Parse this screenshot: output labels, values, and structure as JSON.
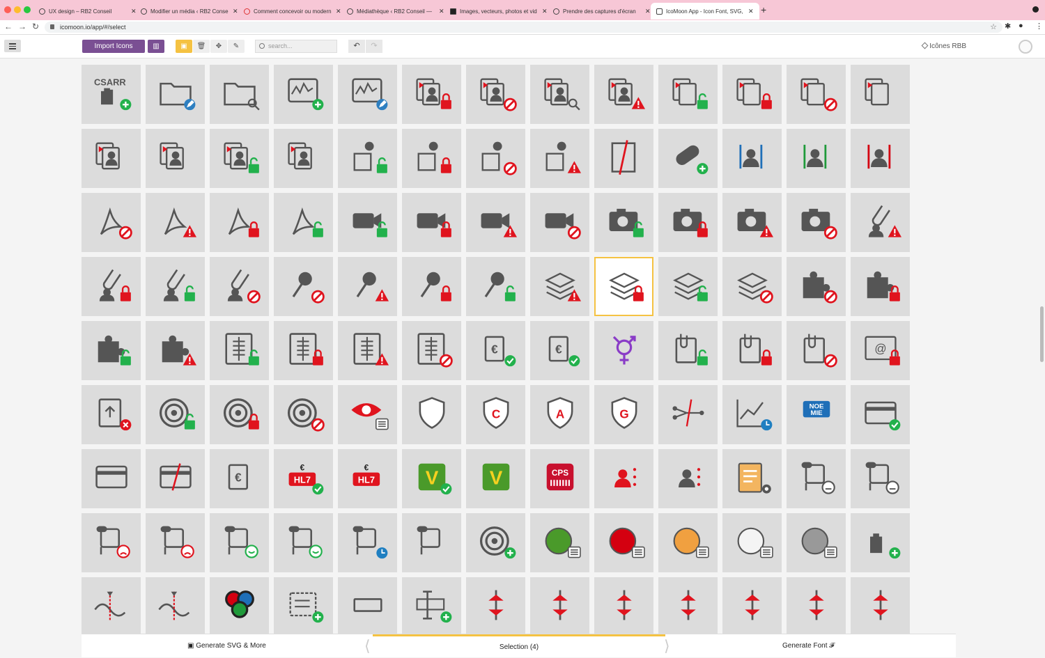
{
  "browser": {
    "tabs": [
      {
        "title": "UX design – RB2 Conseil"
      },
      {
        "title": "Modifier un média ‹ RB2 Conseil"
      },
      {
        "title": "Comment concevoir ou moderniser"
      },
      {
        "title": "Médiathèque ‹ RB2 Conseil —"
      },
      {
        "title": "Images, vecteurs, photos et vid"
      },
      {
        "title": "Prendre des captures d'écran"
      },
      {
        "title": "IcoMoon App - Icon Font, SVG,"
      }
    ],
    "url": "icomoon.io/app/#/select"
  },
  "toolbar": {
    "import_label": "Import Icons",
    "search_placeholder": "search...",
    "project_label": "Icônes RBB"
  },
  "icons": [
    "csarr-hand-add",
    "folder-edit",
    "folder-search",
    "monitor-add",
    "monitor-edit",
    "docs-user-lock",
    "docs-user-block",
    "docs-user-search",
    "docs-user-warning",
    "docs-unlock",
    "docs-lock",
    "docs-block",
    "docs",
    "docs-user-warning-2",
    "docs-user-search-2",
    "docs-user-unlock",
    "docs-user",
    "pin-doc-unlock",
    "pin-doc-lock",
    "pin-doc-block",
    "pin-doc-warning",
    "doc-slash",
    "pill-add",
    "user-bracket-blue",
    "user-bracket-green",
    "user-bracket-red",
    "pdf-block",
    "pdf-warning",
    "pdf-lock",
    "pdf-unlock",
    "video-unlock",
    "video-lock",
    "video-warning",
    "video-block",
    "camera-unlock",
    "camera-lock",
    "camera-warning",
    "camera-block",
    "clip-user-warning",
    "clip-user-lock",
    "clip-user-unlock",
    "clip-user-block",
    "pin-block",
    "pin-warning",
    "pin-lock",
    "pin-unlock",
    "layers-warning",
    "layers-lock",
    "layers-unlock",
    "layers-block",
    "puzzle-block",
    "puzzle-lock",
    "puzzle-unlock",
    "puzzle-warning",
    "xray-unlock",
    "xray-lock",
    "xray-warning",
    "xray-block",
    "euro-building-check",
    "euro-doc-check",
    "transgender",
    "clip-doc-unlock",
    "clip-doc-lock",
    "clip-doc-block",
    "mail-at-lock",
    "upload-doc-delete",
    "radar-unlock",
    "radar-lock",
    "radar-block",
    "eye-list",
    "shield",
    "shield-c",
    "shield-a",
    "shield-g",
    "flow-slash",
    "chart-clock",
    "noemie",
    "card-check",
    "card-check-2",
    "card-slash",
    "euro-docs",
    "hl7-euro-check",
    "hl7-euro",
    "v-check",
    "v-green",
    "cps-card",
    "user-dots-red",
    "user-dots",
    "doc-gear",
    "chat-neutral",
    "chat-neutral-2",
    "chat-sad-red",
    "chat-sad-red-2",
    "chat-happy",
    "chat-happy-2",
    "chat-clock",
    "chat-clock-2",
    "radar-add",
    "circle-green-list",
    "circle-red-list",
    "circle-orange-list",
    "circle-white-list",
    "circle-grey-list",
    "hand-add",
    "curve-red",
    "curve-slash",
    "circles-rgb",
    "list-add",
    "rectangle",
    "cursor-add",
    "compress-vertical",
    "compress-horizontal",
    "expand-horizontal",
    "compress-v-arrows",
    "expand-v-arrows",
    "expand-h-arrows",
    "split-vertical"
  ],
  "selected_index": 47,
  "bottom": {
    "generate_svg": "Generate SVG & More",
    "selection": "Selection (4)",
    "generate_font": "Generate Font"
  },
  "colors": {
    "accent": "#7a4f93",
    "selection": "#f5c242",
    "lock": "#e0141e",
    "unlock": "#22b14c",
    "icon": "#555555"
  }
}
